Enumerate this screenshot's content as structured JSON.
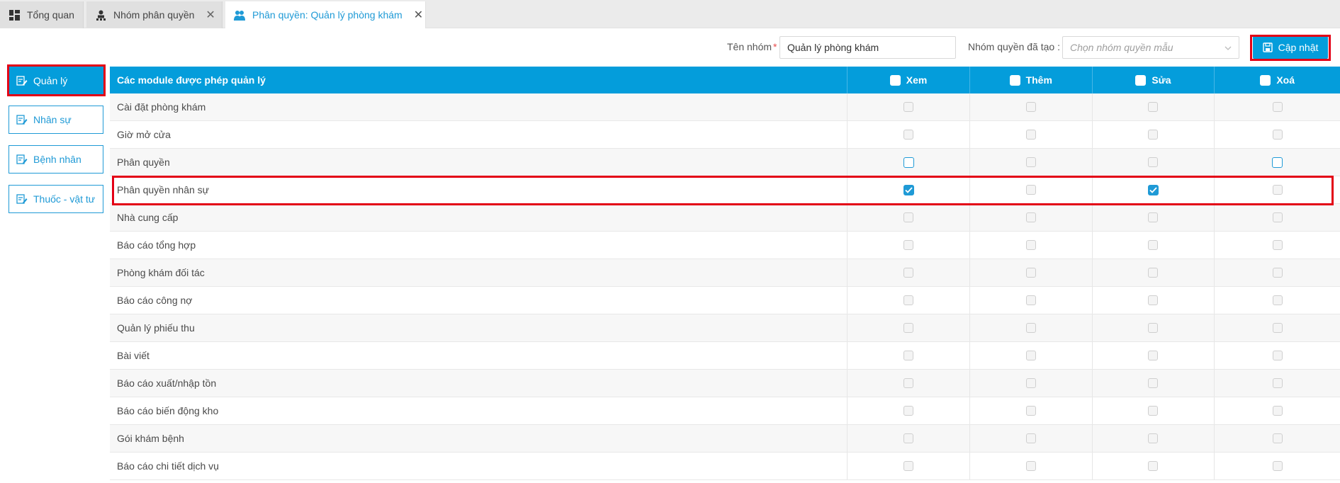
{
  "tabs": [
    {
      "label": "Tổng quan",
      "icon": "dashboard-icon",
      "closable": false,
      "active": false
    },
    {
      "label": "Nhóm phân quyền",
      "icon": "user-group-icon",
      "closable": true,
      "active": false
    },
    {
      "label": "Phân quyền: Quản lý phòng khám",
      "icon": "users-icon",
      "closable": true,
      "active": true
    }
  ],
  "form": {
    "group_name_label": "Tên nhóm",
    "required_mark": "*",
    "group_name_value": "Quản lý phòng khám",
    "template_label": "Nhóm quyền đã tạo :",
    "template_placeholder": "Chọn nhóm quyền mẫu",
    "update_button": "Cập nhật"
  },
  "sidebar": {
    "items": [
      {
        "label": "Quản lý",
        "active": true
      },
      {
        "label": "Nhân sự",
        "active": false
      },
      {
        "label": "Bệnh nhân",
        "active": false
      },
      {
        "label": "Thuốc - vật tư",
        "active": false
      }
    ]
  },
  "table": {
    "header": {
      "module": "Các module được phép quản lý",
      "view": "Xem",
      "add": "Thêm",
      "edit": "Sửa",
      "delete": "Xoá"
    },
    "rows": [
      {
        "name": "Cài đặt phòng khám",
        "perms": [
          "disabled",
          "disabled",
          "disabled",
          "disabled"
        ]
      },
      {
        "name": "Giờ mở cửa",
        "perms": [
          "disabled",
          "disabled",
          "disabled",
          "disabled"
        ]
      },
      {
        "name": "Phân quyền",
        "perms": [
          "enabled",
          "disabled",
          "disabled",
          "enabled"
        ]
      },
      {
        "name": "Phân quyền nhân sự",
        "perms": [
          "checked",
          "disabled",
          "checked",
          "disabled"
        ]
      },
      {
        "name": "Nhà cung cấp",
        "perms": [
          "disabled",
          "disabled",
          "disabled",
          "disabled"
        ]
      },
      {
        "name": "Báo cáo tổng hợp",
        "perms": [
          "disabled",
          "disabled",
          "disabled",
          "disabled"
        ]
      },
      {
        "name": "Phòng khám đối tác",
        "perms": [
          "disabled",
          "disabled",
          "disabled",
          "disabled"
        ]
      },
      {
        "name": "Báo cáo công nợ",
        "perms": [
          "disabled",
          "disabled",
          "disabled",
          "disabled"
        ]
      },
      {
        "name": "Quản lý phiếu thu",
        "perms": [
          "disabled",
          "disabled",
          "disabled",
          "disabled"
        ]
      },
      {
        "name": "Bài viết",
        "perms": [
          "disabled",
          "disabled",
          "disabled",
          "disabled"
        ]
      },
      {
        "name": "Báo cáo xuất/nhập tồn",
        "perms": [
          "disabled",
          "disabled",
          "disabled",
          "disabled"
        ]
      },
      {
        "name": "Báo cáo biến động kho",
        "perms": [
          "disabled",
          "disabled",
          "disabled",
          "disabled"
        ]
      },
      {
        "name": "Gói khám bệnh",
        "perms": [
          "disabled",
          "disabled",
          "disabled",
          "disabled"
        ]
      },
      {
        "name": "Báo cáo chi tiết dịch vụ",
        "perms": [
          "disabled",
          "disabled",
          "disabled",
          "disabled"
        ]
      }
    ]
  },
  "colors": {
    "accent": "#049ddb",
    "highlight": "#e30016"
  }
}
